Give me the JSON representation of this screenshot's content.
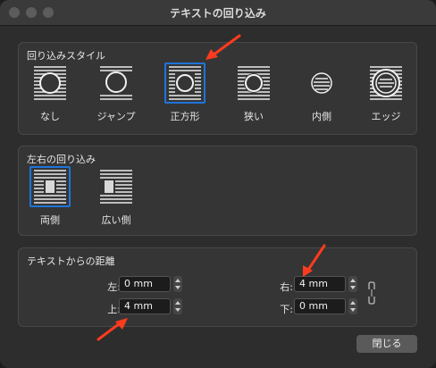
{
  "window": {
    "title": "テキストの回り込み"
  },
  "wrap_style": {
    "label": "回り込みスタイル",
    "options": [
      {
        "label": "なし",
        "selected": false
      },
      {
        "label": "ジャンプ",
        "selected": false
      },
      {
        "label": "正方形",
        "selected": true
      },
      {
        "label": "狭い",
        "selected": false
      },
      {
        "label": "内側",
        "selected": false
      },
      {
        "label": "エッジ",
        "selected": false
      }
    ]
  },
  "side_wrap": {
    "label": "左右の回り込み",
    "options": [
      {
        "label": "両側",
        "selected": true
      },
      {
        "label": "広い側",
        "selected": false
      }
    ]
  },
  "distance": {
    "label": "テキストからの距離",
    "left": {
      "label": "左:",
      "value": "0 mm"
    },
    "right": {
      "label": "右:",
      "value": "4 mm"
    },
    "top": {
      "label": "上:",
      "value": "4 mm"
    },
    "bottom": {
      "label": "下:",
      "value": "0 mm"
    }
  },
  "buttons": {
    "close": "閉じる"
  },
  "colors": {
    "accent": "#1f74d9",
    "arrow": "#ff3b1f"
  }
}
